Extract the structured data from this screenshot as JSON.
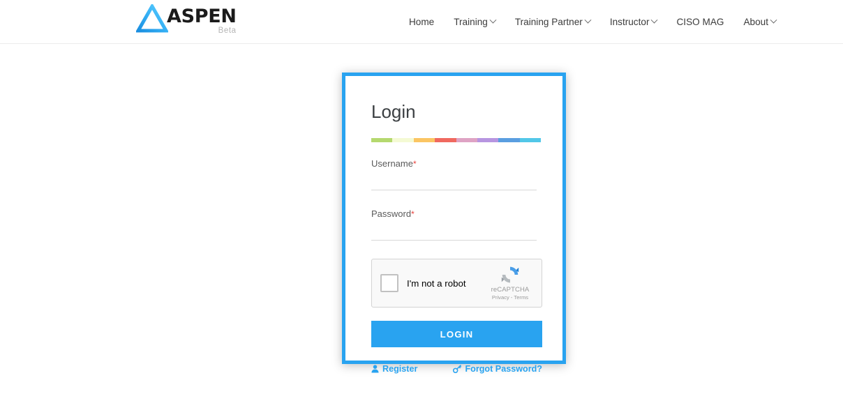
{
  "header": {
    "brand": {
      "logo_icon": "aspen-triangle-logo",
      "name": "ASPEN",
      "tagline": "Beta",
      "logo_color": "#29a3f0"
    },
    "nav": [
      {
        "label": "Home",
        "has_dropdown": false
      },
      {
        "label": "Training",
        "has_dropdown": true
      },
      {
        "label": "Training Partner",
        "has_dropdown": true
      },
      {
        "label": "Instructor",
        "has_dropdown": true
      },
      {
        "label": "CISO MAG",
        "has_dropdown": false
      },
      {
        "label": "About",
        "has_dropdown": true
      }
    ]
  },
  "login_card": {
    "title": "Login",
    "border_color": "#29a3f0",
    "divider_colors": [
      "#b5d96f",
      "#f4fad4",
      "#fbc563",
      "#f0695f",
      "#dea3c4",
      "#b795e0",
      "#5a9ee0",
      "#52c7e8"
    ],
    "fields": [
      {
        "label": "Username",
        "required_mark": "*",
        "value": "",
        "placeholder": ""
      },
      {
        "label": "Password",
        "required_mark": "*",
        "value": "",
        "placeholder": ""
      }
    ],
    "recaptcha": {
      "checkbox_icon": "empty-checkbox",
      "label": "I'm not a robot",
      "logo_icon": "recaptcha-logo",
      "brand": "reCAPTCHA",
      "legal": "Privacy - Terms"
    },
    "submit_label": "LOGIN",
    "links": [
      {
        "label": "Register",
        "icon": "user-icon"
      },
      {
        "label": "Forgot Password?",
        "icon": "key-icon"
      }
    ]
  }
}
